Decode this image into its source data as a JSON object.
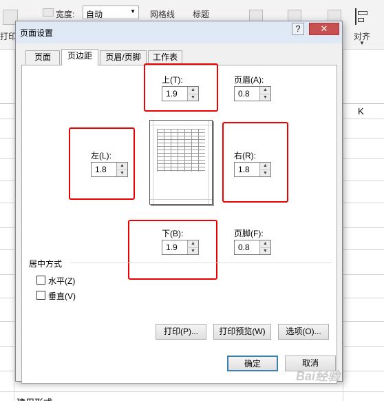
{
  "ribbon": {
    "print_titles": "打印",
    "width_label": "宽度:",
    "width_value": "自动",
    "gridlines": "网格线",
    "headings": "标题",
    "align": "对齐",
    "align_sub": "齐"
  },
  "sheet": {
    "col_k": "K",
    "cell_text": "建用形式"
  },
  "dialog": {
    "title": "页面设置",
    "help": "?",
    "close": "✕",
    "tabs": [
      "页面",
      "页边距",
      "页眉/页脚",
      "工作表"
    ],
    "active_tab": "页边距",
    "top": {
      "label": "上(T):",
      "value": "1.9"
    },
    "header": {
      "label": "页眉(A):",
      "value": "0.8"
    },
    "left": {
      "label": "左(L):",
      "value": "1.8"
    },
    "right": {
      "label": "右(R):",
      "value": "1.8"
    },
    "bottom": {
      "label": "下(B):",
      "value": "1.9"
    },
    "footer": {
      "label": "页脚(F):",
      "value": "0.8"
    },
    "center_group": "居中方式",
    "horizontal": "水平(Z)",
    "vertical": "垂直(V)",
    "btn_print": "打印(P)...",
    "btn_preview": "打印预览(W)",
    "btn_options": "选项(O)...",
    "btn_ok": "确定",
    "btn_cancel": "取消"
  },
  "watermark": "Bai经验",
  "colors": {
    "highlight": "#e00000",
    "titlebar": "#dfe9f5",
    "dialog_bg": "#f0f0f0"
  }
}
